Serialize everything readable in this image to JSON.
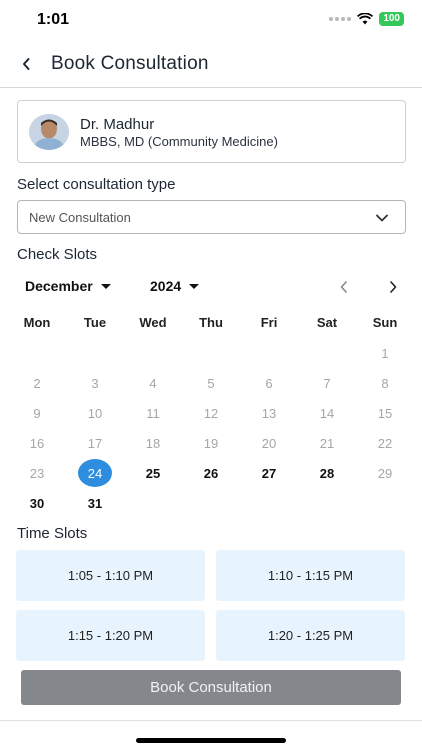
{
  "status_bar": {
    "time": "1:01",
    "battery": "100"
  },
  "header": {
    "title": "Book Consultation",
    "back_icon": "chevron-left-icon"
  },
  "doctor": {
    "name": "Dr. Madhur",
    "qualification": "MBBS, MD (Community Medicine)"
  },
  "consultation": {
    "label": "Select consultation type",
    "selected": "New Consultation"
  },
  "slots_section": {
    "label": "Check Slots"
  },
  "calendar": {
    "month": "December",
    "year": "2024",
    "weekdays": [
      "Mon",
      "Tue",
      "Wed",
      "Thu",
      "Fri",
      "Sat",
      "Sun"
    ],
    "weeks": [
      [
        "",
        "",
        "",
        "",
        "",
        "",
        "1"
      ],
      [
        "2",
        "3",
        "4",
        "5",
        "6",
        "7",
        "8"
      ],
      [
        "9",
        "10",
        "11",
        "12",
        "13",
        "14",
        "15"
      ],
      [
        "16",
        "17",
        "18",
        "19",
        "20",
        "21",
        "22"
      ],
      [
        "23",
        "24",
        "25",
        "26",
        "27",
        "28",
        "29"
      ],
      [
        "30",
        "31",
        "",
        "",
        "",
        "",
        ""
      ]
    ],
    "selected_day": "24",
    "available_days": [
      "25",
      "26",
      "27",
      "28",
      "30",
      "31"
    ]
  },
  "time_slots": {
    "label": "Time Slots",
    "slots": [
      "1:05 - 1:10 PM",
      "1:10 - 1:15 PM",
      "1:15 - 1:20 PM",
      "1:20 - 1:25 PM"
    ]
  },
  "book_button": {
    "label": "Book Consultation"
  },
  "colors": {
    "selected_day": "#2f8de0",
    "slot_bg": "#e8f4fd",
    "button_disabled": "#84888d",
    "battery": "#34c759"
  }
}
